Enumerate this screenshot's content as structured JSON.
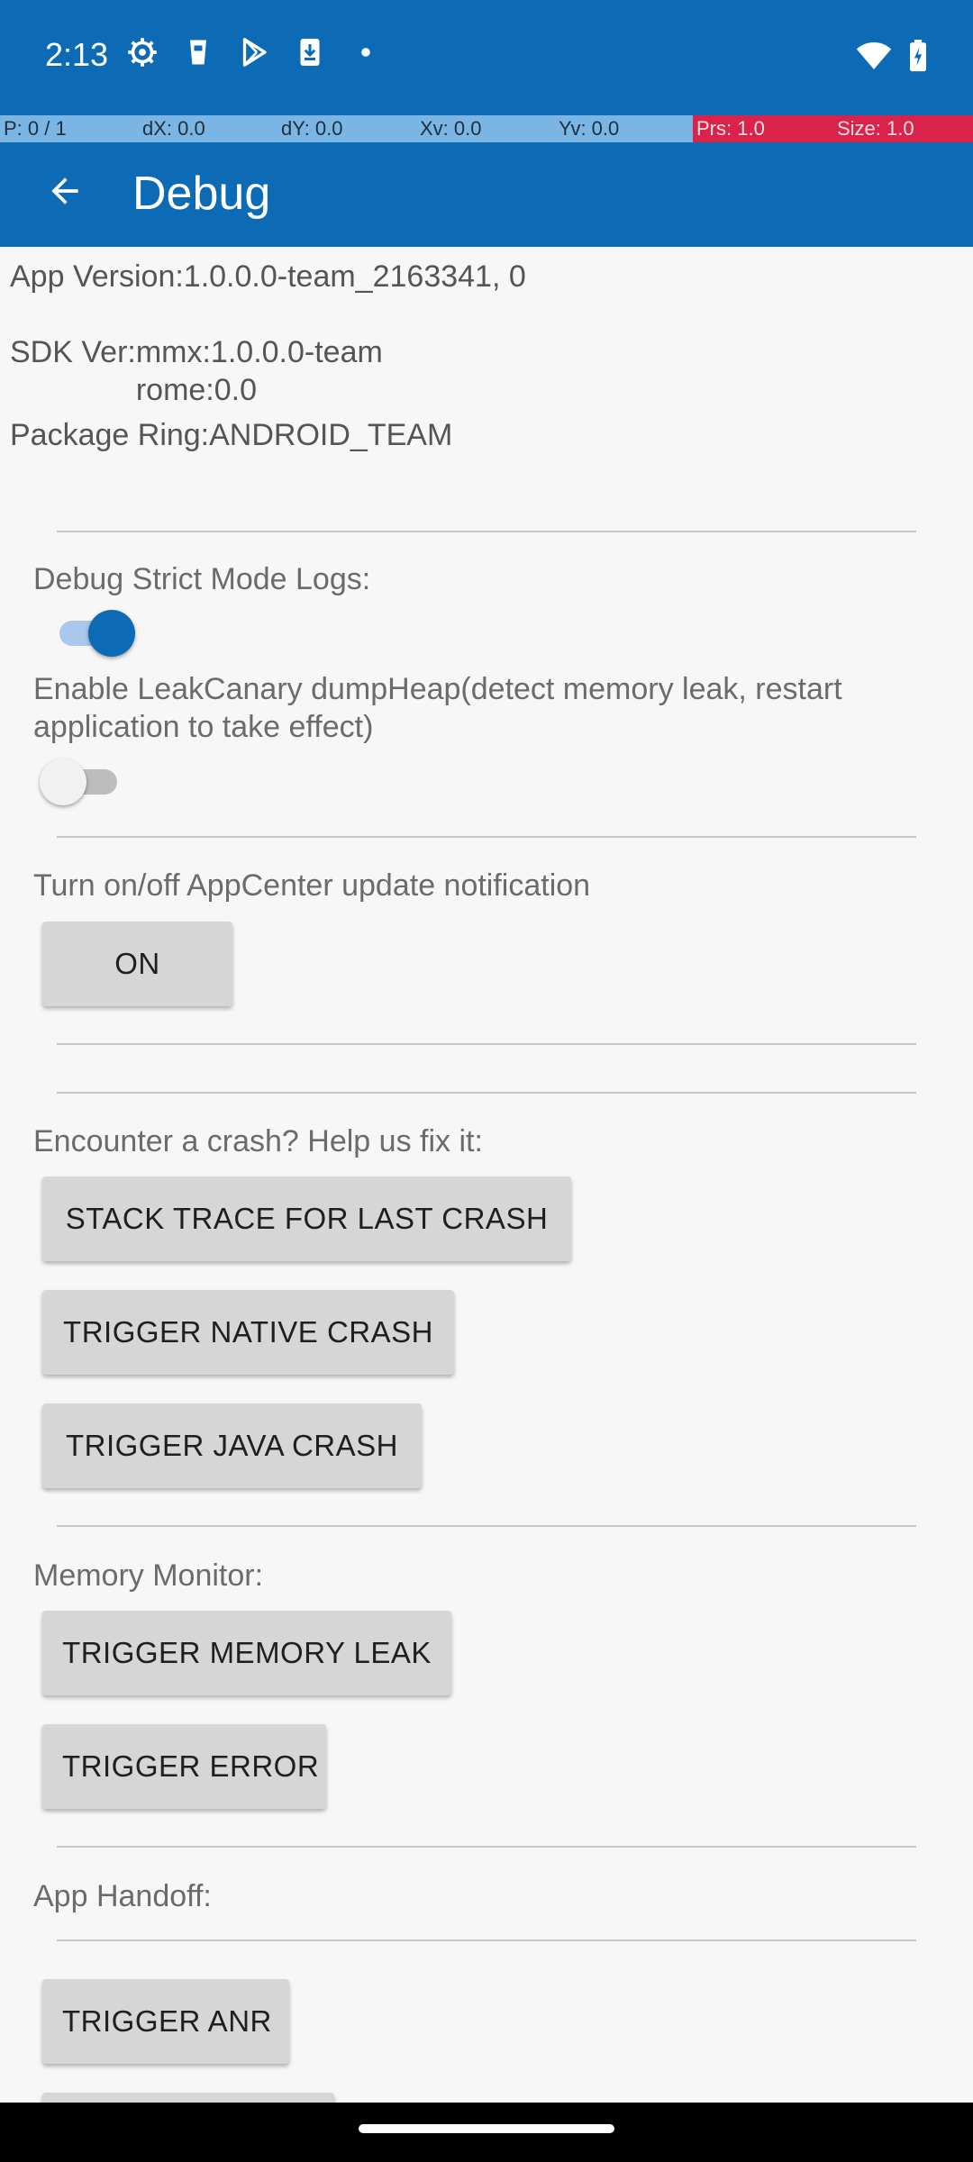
{
  "status_bar": {
    "time": "2:13",
    "left_icons": [
      "settings-gear-icon",
      "cup-icon",
      "play-store-icon",
      "download-icon",
      "dot-icon"
    ],
    "right_icons": [
      "wifi-icon",
      "battery-charging-icon"
    ]
  },
  "pointer_overlay": {
    "p": "P: 0 / 1",
    "dx": "dX: 0.0",
    "dy": "dY: 0.0",
    "xv": "Xv: 0.0",
    "yv": "Yv: 0.0",
    "prs": "Prs: 1.0",
    "size": "Size: 1.0"
  },
  "app_bar": {
    "title": "Debug",
    "back_icon": "arrow-back-icon"
  },
  "info": {
    "app_version": "App Version:1.0.0.0-team_2163341, 0",
    "sdk_label": "SDK Ver:",
    "sdk_line1": "mmx:1.0.0.0-team",
    "sdk_line2": "rome:0.0",
    "package_ring": "Package Ring:ANDROID_TEAM"
  },
  "sections": {
    "strict_mode_label": "Debug Strict Mode Logs:",
    "strict_mode_on": true,
    "leak_canary_label_line1": "Enable LeakCanary dumpHeap(detect memory leak, restart",
    "leak_canary_label_line2": "application to take effect)",
    "leak_canary_on": false,
    "appcenter_label": "Turn on/off AppCenter update notification",
    "appcenter_button": "ON",
    "crash_label": "Encounter a crash? Help us fix it:",
    "stack_trace_button": "STACK TRACE FOR LAST CRASH",
    "native_crash_button": "TRIGGER NATIVE CRASH",
    "java_crash_button": "TRIGGER JAVA CRASH",
    "memory_label": "Memory Monitor:",
    "memory_leak_button": "TRIGGER MEMORY LEAK",
    "error_button": "TRIGGER ERROR",
    "handoff_label": "App Handoff:",
    "anr_button": "TRIGGER ANR"
  },
  "colors": {
    "primary": "#0d6bb5",
    "pointer_blue": "#7bb5e3",
    "pointer_red": "#d9234b",
    "button_bg": "#d6d6d6"
  }
}
